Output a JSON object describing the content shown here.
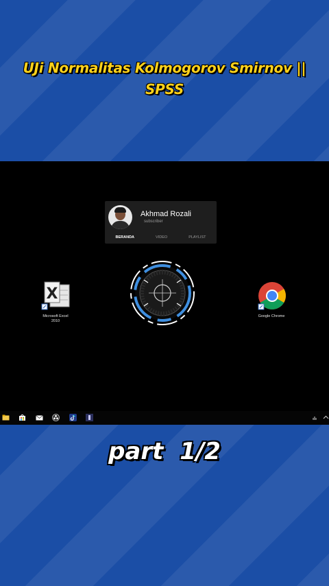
{
  "video": {
    "title_line1": "UJi Normalitas Kolmogorov Smirnov ||",
    "title_line2": "SPSS",
    "caption": "part 1/2"
  },
  "channel_card": {
    "name": "Akhmad Rozali",
    "subtitle": "subscriber",
    "tabs": [
      "BERANDA",
      "VIDEO",
      "PLAYLIST"
    ],
    "active_tab": "BERANDA"
  },
  "desktop": {
    "icons": [
      {
        "label_line1": "Microsoft Excel",
        "label_line2": "2010",
        "icon": "excel-icon"
      },
      {
        "label_line1": "Google Chrome",
        "label_line2": "",
        "icon": "chrome-icon"
      }
    ]
  },
  "taskbar": {
    "apps": [
      "file-explorer-icon",
      "store-icon",
      "mail-icon",
      "obs-icon",
      "tiktok-icon",
      "app-icon"
    ],
    "tray": [
      "network-icon",
      "chevron-up-icon"
    ]
  },
  "colors": {
    "background": "#1b4ea6",
    "title": "#ffd21a",
    "caption": "#ffffff",
    "hud_accent": "#3f8fe0"
  }
}
